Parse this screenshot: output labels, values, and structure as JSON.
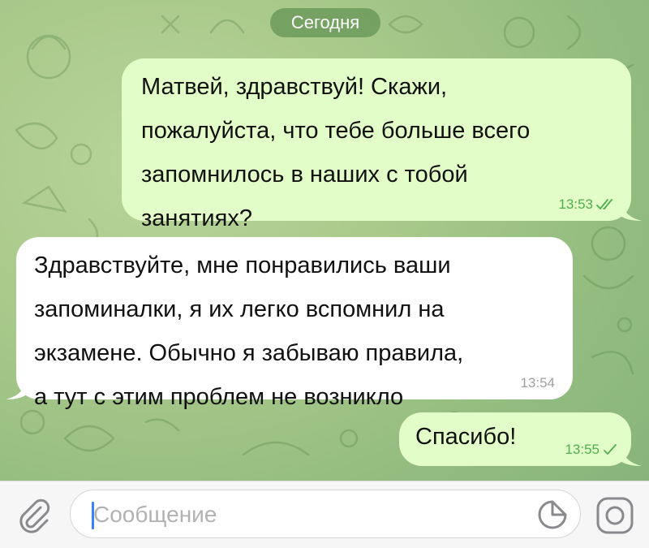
{
  "chat": {
    "date_label": "Сегодня",
    "messages": [
      {
        "direction": "outgoing",
        "text": "Матвей, здравствуй! Скажи,\nпожалуйста, что тебе больше всего\nзапомнилось в наших с тобой\nзанятиях?",
        "time": "13:53",
        "status": "read"
      },
      {
        "direction": "incoming",
        "text": "Здравствуйте, мне понравились ваши\nзапоминалки, я их легко вспомнил на\nэкзамене. Обычно я забываю правила,\nа тут с этим проблем не возникло",
        "time": "13:54"
      },
      {
        "direction": "outgoing",
        "text": "Спасибо!",
        "time": "13:55",
        "status": "sent"
      }
    ]
  },
  "composer": {
    "placeholder": "Сообщение",
    "value": "",
    "icons": {
      "attach": "paperclip-icon",
      "sticker": "sticker-icon",
      "camera": "camera-icon"
    }
  },
  "colors": {
    "outgoing_bubble": "#e3fdc8",
    "incoming_bubble": "#ffffff",
    "read_check": "#4fae4e",
    "caret": "#3b82f6",
    "date_pill": "#6c9a5c"
  }
}
